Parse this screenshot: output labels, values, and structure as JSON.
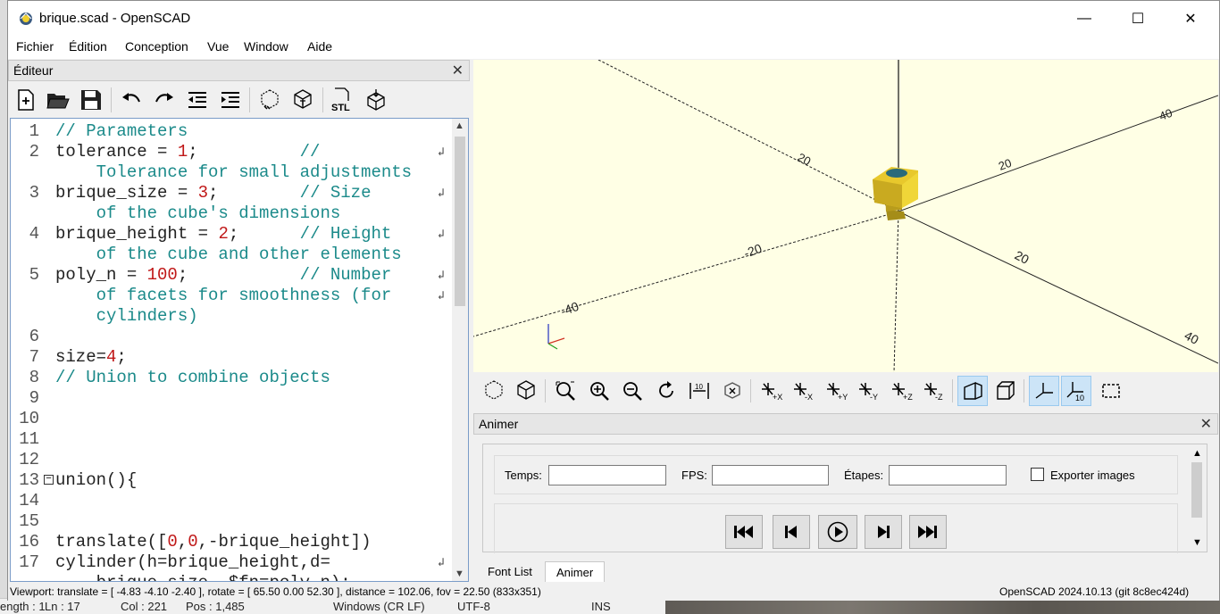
{
  "window": {
    "title": "brique.scad - OpenSCAD",
    "minimize": "—",
    "maximize": "☐",
    "close": "✕"
  },
  "menu": [
    "Fichier",
    "Édition",
    "Conception",
    "Vue",
    "Window",
    "Aide"
  ],
  "editor": {
    "title": "Éditeur",
    "close": "✕",
    "lines": [
      {
        "n": "1",
        "parts": [
          {
            "t": "// Parameters",
            "c": "c-comment"
          }
        ]
      },
      {
        "n": "2",
        "parts": [
          {
            "t": "tolerance = ",
            "c": ""
          },
          {
            "t": "1",
            "c": "c-num"
          },
          {
            "t": ";          ",
            "c": ""
          },
          {
            "t": "//",
            "c": "c-comment"
          }
        ],
        "wrap": true
      },
      {
        "n": "",
        "parts": [
          {
            "t": "    Tolerance for small adjustments",
            "c": "c-comment"
          }
        ]
      },
      {
        "n": "3",
        "parts": [
          {
            "t": "brique_size = ",
            "c": ""
          },
          {
            "t": "3",
            "c": "c-num"
          },
          {
            "t": ";        ",
            "c": ""
          },
          {
            "t": "// Size",
            "c": "c-comment"
          }
        ],
        "wrap": true
      },
      {
        "n": "",
        "parts": [
          {
            "t": "    of the cube's dimensions",
            "c": "c-comment"
          }
        ]
      },
      {
        "n": "4",
        "parts": [
          {
            "t": "brique_height = ",
            "c": ""
          },
          {
            "t": "2",
            "c": "c-num"
          },
          {
            "t": ";      ",
            "c": ""
          },
          {
            "t": "// Height",
            "c": "c-comment"
          }
        ],
        "wrap": true
      },
      {
        "n": "",
        "parts": [
          {
            "t": "    of the cube and other elements",
            "c": "c-comment"
          }
        ]
      },
      {
        "n": "5",
        "parts": [
          {
            "t": "poly_n = ",
            "c": ""
          },
          {
            "t": "100",
            "c": "c-num"
          },
          {
            "t": ";           ",
            "c": ""
          },
          {
            "t": "// Number",
            "c": "c-comment"
          }
        ],
        "wrap": true
      },
      {
        "n": "",
        "parts": [
          {
            "t": "    of facets for smoothness (for",
            "c": "c-comment"
          }
        ],
        "wrap": true
      },
      {
        "n": "",
        "parts": [
          {
            "t": "    cylinders)",
            "c": "c-comment"
          }
        ]
      },
      {
        "n": "6",
        "parts": []
      },
      {
        "n": "7",
        "parts": [
          {
            "t": "size=",
            "c": ""
          },
          {
            "t": "4",
            "c": "c-num"
          },
          {
            "t": ";",
            "c": ""
          }
        ]
      },
      {
        "n": "8",
        "parts": [
          {
            "t": "// Union to combine objects",
            "c": "c-comment"
          }
        ]
      },
      {
        "n": "9",
        "parts": []
      },
      {
        "n": "10",
        "parts": []
      },
      {
        "n": "11",
        "parts": []
      },
      {
        "n": "12",
        "parts": []
      },
      {
        "n": "13",
        "parts": [
          {
            "t": "union(){",
            "c": ""
          }
        ],
        "fold": true
      },
      {
        "n": "14",
        "parts": []
      },
      {
        "n": "15",
        "parts": []
      },
      {
        "n": "16",
        "parts": [
          {
            "t": "translate([",
            "c": ""
          },
          {
            "t": "0",
            "c": "c-num"
          },
          {
            "t": ",",
            "c": ""
          },
          {
            "t": "0",
            "c": "c-num"
          },
          {
            "t": ",-brique_height])",
            "c": ""
          }
        ]
      },
      {
        "n": "17",
        "parts": [
          {
            "t": "cylinder(h=brique_height,d=",
            "c": ""
          }
        ],
        "wrap": true
      },
      {
        "n": "",
        "parts": [
          {
            "t": "    brique_size, $fn=poly_n);",
            "c": ""
          }
        ]
      }
    ]
  },
  "animate": {
    "title": "Animer",
    "close": "✕",
    "time_label": "Temps:",
    "time_value": "",
    "fps_label": "FPS:",
    "fps_value": "",
    "steps_label": "Étapes:",
    "steps_value": "",
    "export_label": "Exporter images"
  },
  "tabs": {
    "font_list": "Font List",
    "animate": "Animer"
  },
  "status": {
    "viewport": "Viewport: translate = [ -4.83 -4.10 -2.40 ], rotate = [ 65.50 0.00 52.30 ], distance = 102.06, fov = 22.50 (833x351)",
    "version": "OpenSCAD 2024.10.13 (git 8c8ec424d)"
  },
  "behind_status": {
    "length": "ength : 1",
    "ln": "Ln : 17",
    "col": "Col : 221",
    "pos": "Pos : 1,485",
    "eol": "Windows (CR LF)",
    "enc": "UTF-8",
    "ins": "INS"
  },
  "viewport_labels": {
    "t1": "20",
    "t2": "20",
    "t3": "40",
    "t4": "-20",
    "t5": "-40",
    "t6": "20",
    "t7": "40"
  },
  "colors": {
    "viewport_bg": "#ffffe5",
    "object": "#f0d030",
    "comment": "#1b8a8a",
    "number": "#c01818"
  }
}
